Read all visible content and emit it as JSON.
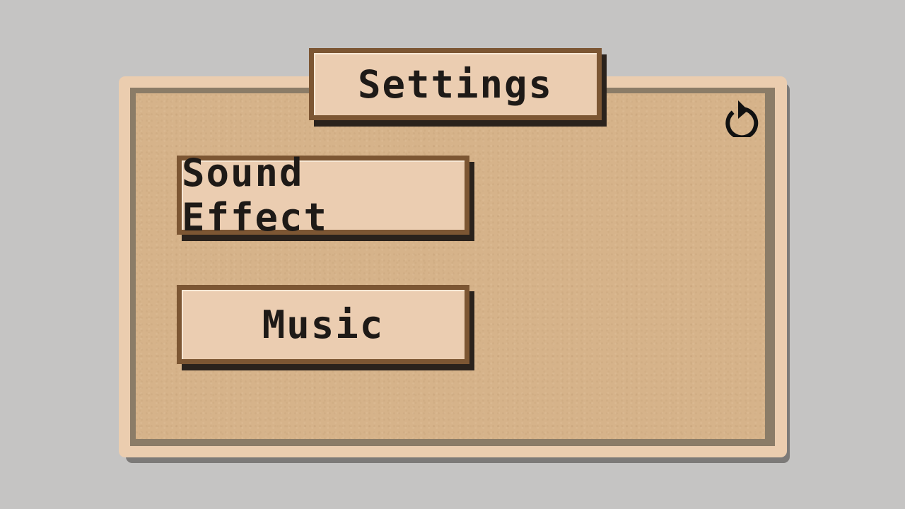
{
  "title": "Settings",
  "buttons": {
    "sound_effect": "Sound Effect",
    "music": "Music"
  },
  "icons": {
    "reset": "reset-icon"
  },
  "colors": {
    "background": "#c5c4c3",
    "panel_outer": "#ebcdaf",
    "panel_border": "#8b7c67",
    "board": "#d6b38a",
    "button_fill": "#ebcdb1",
    "button_border": "#7c5633",
    "button_shadow": "#2a221c",
    "text": "#1e1a17"
  }
}
